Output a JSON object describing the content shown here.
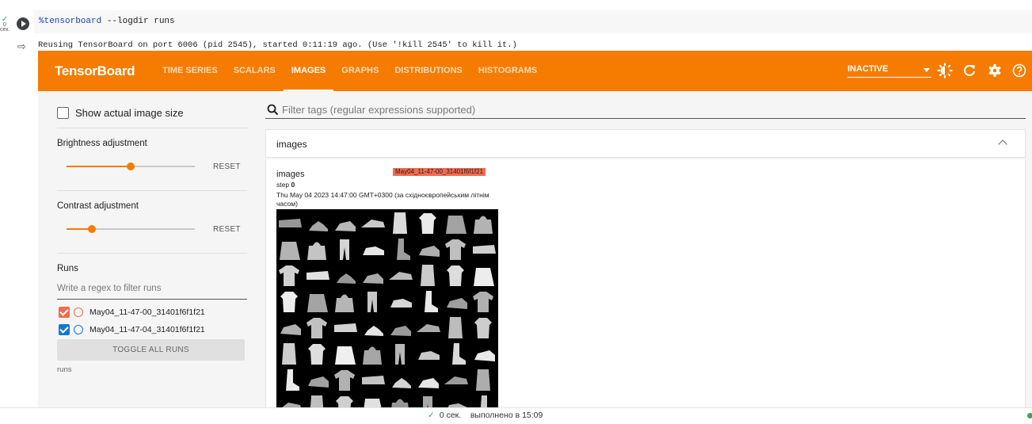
{
  "cell": {
    "exec_check": "✓",
    "exec_count": "0",
    "exec_unit": "сек.",
    "code_magic": "%tensorboard",
    "code_args": " --logdir runs",
    "output": "Reusing TensorBoard on port 6006 (pid 2545), started 0:11:19 ago. (Use '!kill 2545' to kill it.)"
  },
  "tensorboard": {
    "brand": "TensorBoard",
    "tabs": [
      {
        "label": "TIME SERIES"
      },
      {
        "label": "SCALARS"
      },
      {
        "label": "IMAGES",
        "active": true
      },
      {
        "label": "GRAPHS"
      },
      {
        "label": "DISTRIBUTIONS"
      },
      {
        "label": "HISTOGRAMS"
      }
    ],
    "status_select": "INACTIVE",
    "icons": [
      "brightness-icon",
      "refresh-icon",
      "settings-icon",
      "help-icon"
    ],
    "colors": {
      "header": "#f57c00",
      "run1": "#f26b4f",
      "run2": "#1976d2"
    }
  },
  "sidebar": {
    "show_actual_size": "Show actual image size",
    "brightness": {
      "label": "Brightness adjustment",
      "reset": "RESET",
      "value": 0.5
    },
    "contrast": {
      "label": "Contrast adjustment",
      "reset": "RESET",
      "value": 0.2
    },
    "runs": {
      "title": "Runs",
      "placeholder": "Write a regex to filter runs",
      "items": [
        {
          "name": "May04_11-47-00_31401f6f1f21",
          "color": "#f26b4f",
          "checked": true
        },
        {
          "name": "May04_11-47-04_31401f6f1f21",
          "color": "#1976d2",
          "checked": true
        }
      ],
      "toggle_all": "TOGGLE ALL RUNS",
      "footer": "runs"
    }
  },
  "main": {
    "filter_placeholder": "Filter tags (regular expressions supported)",
    "group_label": "images",
    "card": {
      "tag": "images",
      "run": "May04_11-47-00_31401f6f1f21",
      "step_label": "step",
      "step_value": "0",
      "timestamp": "Thu May 04 2023 14:47:00 GMT+0300 (за східноєвропейським літнім часом)"
    }
  },
  "status": {
    "check": "✓",
    "text": "0 сек.    выполнено в 15:09"
  }
}
